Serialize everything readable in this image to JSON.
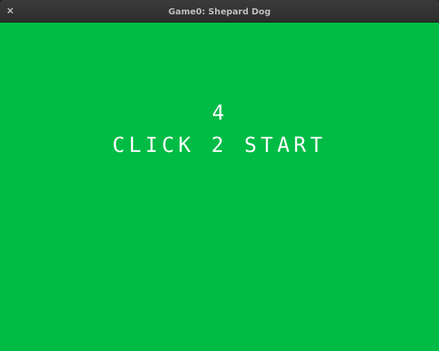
{
  "window": {
    "title": "Game0: Shepard Dog",
    "close_glyph": "×"
  },
  "game": {
    "countdown": "4",
    "prompt": "CLICK 2 START",
    "background_color": "#00bc45",
    "text_color": "#ffffff"
  }
}
